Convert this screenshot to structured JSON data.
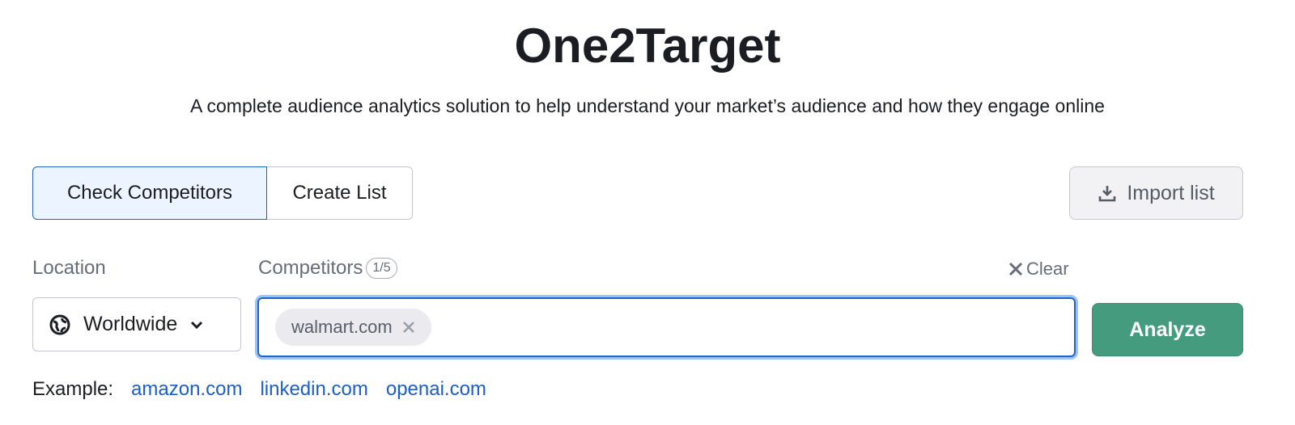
{
  "title": "One2Target",
  "subtitle": "A complete audience analytics solution to help understand your market’s audience and how they engage online",
  "tabs": [
    {
      "label": "Check Competitors",
      "active": true
    },
    {
      "label": "Create List",
      "active": false
    }
  ],
  "import_label": "Import list",
  "location": {
    "label": "Location",
    "value": "Worldwide",
    "icon": "globe-icon"
  },
  "competitors": {
    "label": "Competitors",
    "count": "1/5",
    "clear_label": "Clear",
    "chips": [
      "walmart.com"
    ]
  },
  "analyze_label": "Analyze",
  "examples": {
    "label": "Example:",
    "links": [
      "amazon.com",
      "linkedin.com",
      "openai.com"
    ]
  },
  "colors": {
    "accent": "#1d62c8",
    "analyze": "#449b7e",
    "link": "#1a5fc8"
  }
}
